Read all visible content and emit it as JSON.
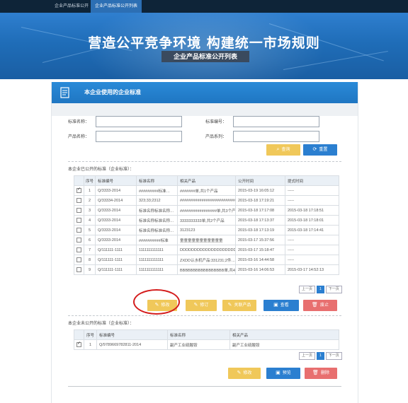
{
  "topnav": {
    "tab1": "企业产品标准公开",
    "tab2": "企业产品标准公开列表"
  },
  "banner": {
    "title": "营造公平竞争环境 构建统一市场规则",
    "subtitle": "企业产品标准公开列表"
  },
  "panel": {
    "title": "本企业使用的企业标准"
  },
  "form": {
    "std_name_label": "标准名称：",
    "std_no_label": "标准编号：",
    "product_name_label": "产品名称：",
    "product_type_label": "产品系列：",
    "query_btn": "查询",
    "reset_btn": "重置"
  },
  "public_section": {
    "title": "本企业已公开的标准（企业标准）：",
    "headers": [
      "",
      "序号",
      "标准编号",
      "标准名称",
      "相关产品",
      "公开时间",
      "提式时间"
    ],
    "rows": [
      {
        "checked": true,
        "no": "1",
        "code": "Q/3333-2014",
        "name": "#########标准…",
        "product": "#######单,共1个产品",
        "pub": "2015-03-19 16:05:12",
        "sub": "-----"
      },
      {
        "checked": false,
        "no": "2",
        "code": "Q/33334-2014",
        "name": "323;33;2312",
        "product": "##########################",
        "pub": "2015-03-18 17:19:21",
        "sub": "-----"
      },
      {
        "checked": false,
        "no": "3",
        "code": "Q/3333-2014",
        "name": "标准名称标准名称…",
        "product": "#################单,共3个产品",
        "pub": "2015-03-18 17:17:08",
        "sub": "2015-03-18 17:18:51"
      },
      {
        "checked": false,
        "no": "4",
        "code": "Q/3333-2014",
        "name": "标准名称标准名称…",
        "product": "3333333333单,共2个产品",
        "pub": "2015-03-18 17:13:37",
        "sub": "2015-03-18 17:18:01"
      },
      {
        "checked": false,
        "no": "5",
        "code": "Q/3333-2014",
        "name": "标准名称标准名称…",
        "product": "3123123",
        "pub": "2015-03-18 17:13:19",
        "sub": "2015-03-18 17:14:41"
      },
      {
        "checked": false,
        "no": "6",
        "code": "Q/3333-2014",
        "name": "##########标准",
        "product": "童童童童童童童童童童童",
        "pub": "2015-03-17 15:37:56",
        "sub": "-----"
      },
      {
        "checked": false,
        "no": "7",
        "code": "Q/111111-1111",
        "name": "1111111111111",
        "product": "DDDDDDDDDDDDDDDDDDDDDD…",
        "pub": "2015-03-17 15:18:47",
        "sub": "-----"
      },
      {
        "checked": false,
        "no": "8",
        "code": "Q/111111-1111",
        "name": "1111111111111",
        "product": "ZXDD认水机产品:331231;2件…",
        "pub": "2015-03-16 14:44:58",
        "sub": "-----"
      },
      {
        "checked": false,
        "no": "9",
        "code": "Q/111111-1111",
        "name": "1111111111111",
        "product": "BBBBBBBBBBBBBBBBB单,共4…",
        "pub": "2015-03-16 14:06:53",
        "sub": "2015-03-17 14:52:13"
      }
    ],
    "pager": {
      "prev": "上一页",
      "page": "1",
      "next": "下一页"
    },
    "actions": {
      "btn1": "修改",
      "btn2": "修订",
      "btn3": "关联产品",
      "btn4": "查看",
      "btn5": "废止"
    }
  },
  "private_section": {
    "title": "本企业未公开的标准（企业标准）：",
    "headers": [
      "",
      "序号",
      "标准编号",
      "标准名称",
      "相关产品"
    ],
    "rows": [
      {
        "checked": true,
        "no": "1",
        "code": "Q/9789669782811-2014",
        "name": "副产工业硫酸铵",
        "product": "副产工业硫酸铵"
      }
    ],
    "pager": {
      "prev": "上一页",
      "page": "1",
      "next": "下一页"
    },
    "actions": {
      "btn1": "修改",
      "btn2": "预览",
      "btn3": "删除"
    }
  }
}
